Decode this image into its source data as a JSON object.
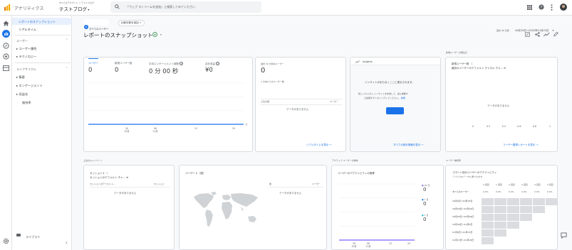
{
  "app": {
    "product": "アナリティクス",
    "account_line": "すべてのアカウント > テストブログ",
    "property": "テストブログ",
    "search_placeholder": "「ウェブ ストリームを追加」と検索してみてください"
  },
  "nav": {
    "top_items": [
      {
        "label": "レポートのスナップショット"
      },
      {
        "label": "リアルタイム"
      }
    ],
    "sections": [
      {
        "title": "ユーザー",
        "items": [
          "ユーザー属性",
          "テクノロジー"
        ]
      },
      {
        "title": "ライフサイクル",
        "items": [
          "集客",
          "エンゲージメント",
          "収益化",
          "維持率"
        ]
      }
    ],
    "library": "ライブラリ",
    "collapse": "‹"
  },
  "filters": {
    "chip": "すべてのユーザー",
    "compare": "比較対象を追加 +",
    "date_label": "過去 28 日間",
    "date_range": "10月25日～2022年11月21日"
  },
  "page": {
    "title": "レポートのスナップショット"
  },
  "metrics": {
    "tabs": [
      {
        "label": "ユーザー",
        "value": "0",
        "info": ""
      },
      {
        "label": "新規ユーザー数",
        "value": "0",
        "info": ""
      },
      {
        "label": "平均エンゲージメント時間",
        "value": "0 分 00 秒",
        "info": "?"
      },
      {
        "label": "合計収益",
        "value": "¥0",
        "info": "?"
      }
    ]
  },
  "chart_data": {
    "type": "line",
    "series": [
      {
        "values": [
          0,
          0,
          0,
          0,
          0
        ]
      }
    ],
    "x": [
      "30 10月",
      "06 11月",
      "13",
      "20"
    ],
    "ylim": [
      0,
      1
    ],
    "y_ticks": [
      "0"
    ],
    "legend": "none",
    "grid": true
  },
  "realtime": {
    "title": "過去 30 分間のユーザー",
    "value": "0",
    "per_minute": "1 分あたりのユーザー数",
    "col_left": "上位の国",
    "col_right": "ユーザー",
    "no_data": "データがありません",
    "link": "リアルタイムを表示 →"
  },
  "insights": {
    "title": "Insights",
    "line1": "インサイトがまもなくここに表示されます。",
    "line2a": "新しいカスタム インサイトを作成して、最も重要す",
    "line2b": "る指標をモニタリングしてください。",
    "line2_link": "詳細",
    "button": "作成",
    "link": "すべての統計情報を表示 →"
  },
  "new_users": {
    "header": "新規ユーザーの発生元",
    "title_line1": "新規ユーザー数 （",
    "title_line2": "最初のユーザーのデフォルト チャネル グル… ▾）",
    "no_data": "データがありません",
    "x_ticks": [
      "0",
      "0.2",
      "0.4",
      "0.6",
      "0.8",
      "1"
    ],
    "link": "ユーザー獲得レポートを表示 →"
  },
  "campaigns": {
    "header": "上位のキャンペーン",
    "title_line1": "セッション ▾ （",
    "title_line2": "セッションのデフォルト チャ… ▾）",
    "col_left": "セッションのデフォルト…",
    "col_right": "セッション",
    "no_data": "データがありません"
  },
  "geo": {
    "title": "ユーザー ▾ （国）",
    "col_left": "国",
    "col_right": "ユーザー",
    "no_data": "データがありません"
  },
  "active": {
    "header": "アクティブ ユーザーの傾向",
    "title": "ユーザーのアクティビティの推移",
    "legend": [
      {
        "label": "30 日",
        "value": "0"
      },
      {
        "label": "7 日",
        "value": "0"
      },
      {
        "label": "1 日",
        "value": "0"
      }
    ],
    "x": [
      "30 10月",
      "06 11月",
      "13",
      "20"
    ]
  },
  "retention": {
    "header": "ユーザー維持率",
    "title": "コホート別のユーザーのアクティビティ",
    "subtitle": "デバイスのデータに基づきます",
    "weeks": [
      "0 週目",
      "1 週目",
      "2 週目",
      "3 週目",
      "4 週目",
      "5 週目"
    ],
    "all_label": "すべてのユーザー",
    "all_values": [
      "0.0%",
      "0.0%",
      "0.0%",
      "0.0%",
      "0.0%",
      "0.0%"
    ],
    "rows": [
      "10月9日～10月15日",
      "10月16日～10月22日",
      "10月23日～10月29日",
      "10月30日～11月5日",
      "11月6日～11月12日",
      "11月13日～11月19日"
    ]
  },
  "colors": {
    "accent": "#1a73e8",
    "chart_line": "#4285f4",
    "brand_orange": "#f9ab00",
    "active_line": "#7b61ff"
  }
}
